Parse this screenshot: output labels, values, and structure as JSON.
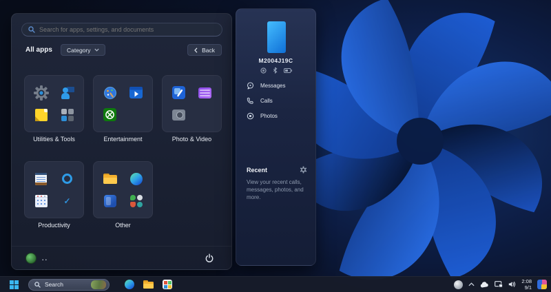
{
  "colors": {
    "accent_blue": "#3ab6f0",
    "panel_bg": "#1d2436",
    "tile_bg": "#272e42",
    "taskbar_bg": "#171c2a",
    "wallpaper_dark": "#0a0f1d",
    "bloom_blue": "#1c5fd8"
  },
  "start_menu": {
    "search_placeholder": "Search for apps, settings, and documents",
    "all_apps_label": "All apps",
    "category_button": "Category",
    "back_button": "Back",
    "categories": [
      {
        "label": "Utilities & Tools",
        "icons": [
          "settings",
          "quick-assist",
          "sticky-notes",
          "more-utilities"
        ]
      },
      {
        "label": "Entertainment",
        "icons": [
          "paint",
          "movies-tv",
          "xbox"
        ]
      },
      {
        "label": "Photo & Video",
        "icons": [
          "photos",
          "video-editor",
          "camera"
        ]
      },
      {
        "label": "Productivity",
        "icons": [
          "notepad",
          "cortana",
          "calendar",
          "to-do"
        ]
      },
      {
        "label": "Other",
        "icons": [
          "file-explorer",
          "edge",
          "store-window",
          "more-apps"
        ]
      }
    ],
    "user_label": "..",
    "footer_icons": [
      "avatar",
      "power"
    ]
  },
  "phone_panel": {
    "device_name": "M2004J19C",
    "status_icons": [
      "signal",
      "bluetooth",
      "battery"
    ],
    "menu_items": [
      {
        "label": "Messages",
        "icon": "message-icon"
      },
      {
        "label": "Calls",
        "icon": "phone-icon"
      },
      {
        "label": "Photos",
        "icon": "photo-icon"
      }
    ],
    "recent_title": "Recent",
    "recent_settings_icon": "gear-icon",
    "recent_description": "View your recent calls, messages, photos, and more."
  },
  "taskbar": {
    "start_icon": "windows-logo",
    "search_label": "Search",
    "search_thumb_icon": "bing-daily-image",
    "pinned_icons": [
      "edge",
      "file-explorer",
      "microsoft-store"
    ],
    "tray_icons": [
      "weather",
      "hidden-icons-chevron",
      "onedrive-cloud",
      "cast-display",
      "volume"
    ],
    "clock_time": "2:08",
    "clock_date": "9/1",
    "corner_icon": "colorful-app-icon"
  }
}
